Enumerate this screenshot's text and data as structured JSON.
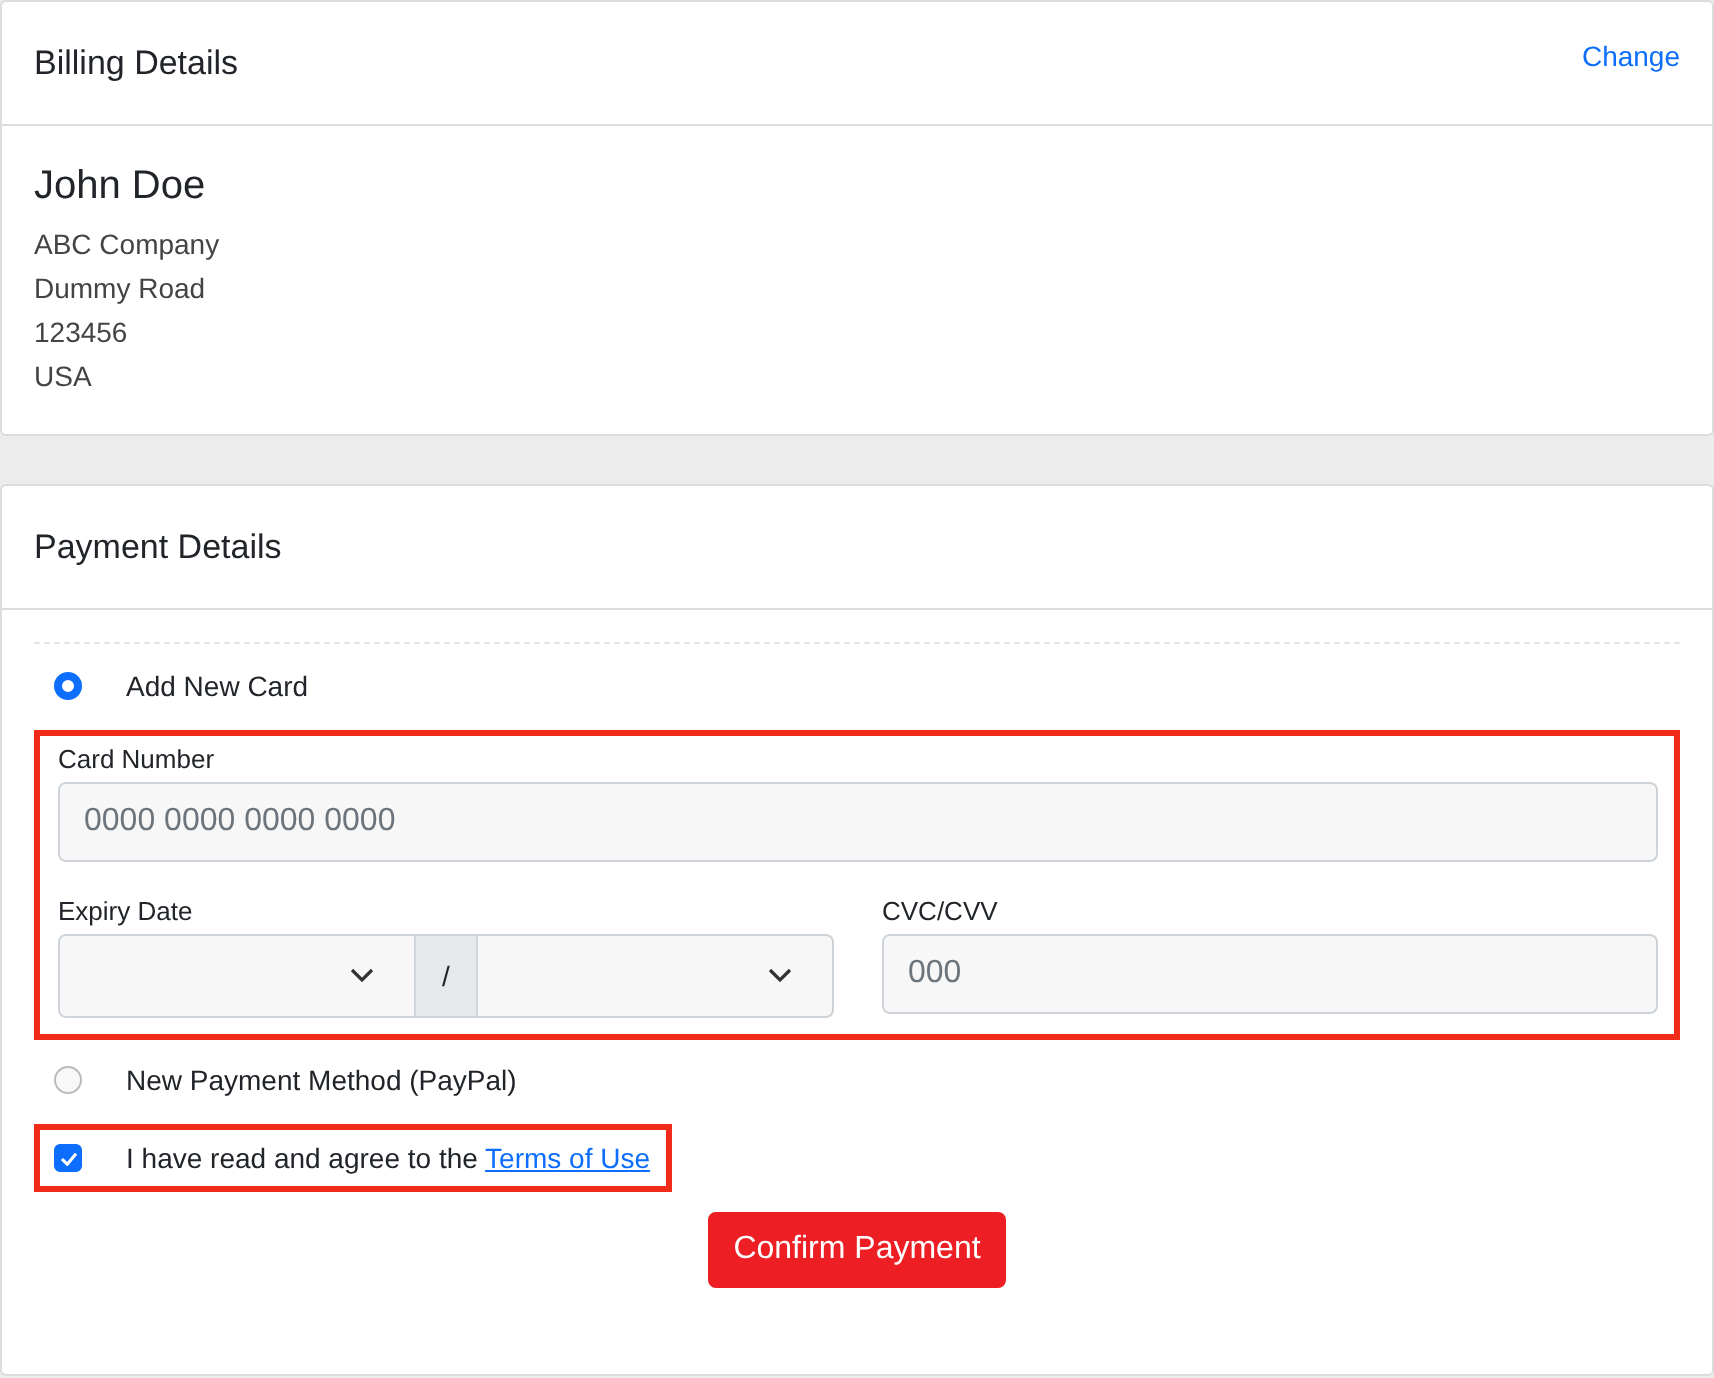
{
  "billing": {
    "title": "Billing Details",
    "action": "Change",
    "name": "John Doe",
    "address_lines": [
      "ABC Company",
      "Dummy Road",
      "123456",
      "USA"
    ]
  },
  "payment": {
    "title": "Payment Details",
    "methods": [
      {
        "label": "Add New Card",
        "selected": true
      },
      {
        "label": "New Payment Method (PayPal)",
        "selected": false
      }
    ],
    "card_fields": {
      "highlighted": true,
      "card_number": {
        "label": "Card Number",
        "placeholder": "0000 0000 0000 0000"
      },
      "expiry": {
        "label": "Expiry Date",
        "separator": "/"
      },
      "cvc": {
        "label": "CVC/CVV",
        "placeholder": "000"
      }
    },
    "terms": {
      "highlighted": true,
      "checked": true,
      "text": "I have read and agree to the ",
      "link": "Terms of Use"
    },
    "submit": "Confirm Payment"
  }
}
